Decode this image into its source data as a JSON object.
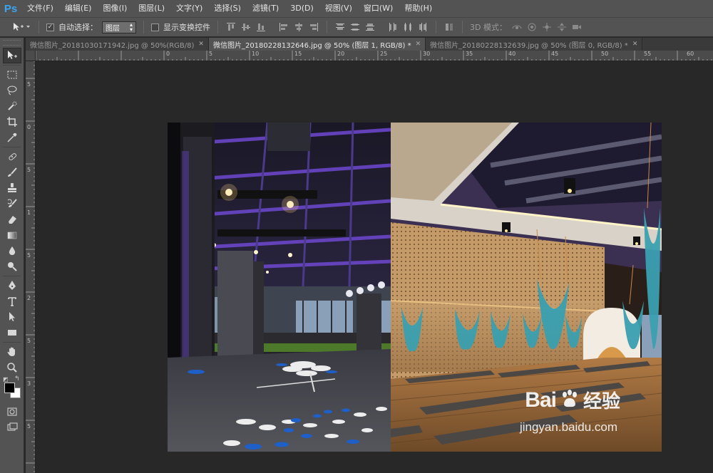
{
  "app": {
    "logo": "Ps"
  },
  "menu": [
    "文件(F)",
    "编辑(E)",
    "图像(I)",
    "图层(L)",
    "文字(Y)",
    "选择(S)",
    "滤镜(T)",
    "3D(D)",
    "视图(V)",
    "窗口(W)",
    "帮助(H)"
  ],
  "options": {
    "auto_select_label": "自动选择：",
    "auto_select_checked": true,
    "auto_select_value": "图层",
    "show_transform_label": "显示变换控件",
    "show_transform_checked": false,
    "mode_3d_label": "3D 模式："
  },
  "tabs": [
    {
      "title": "微信图片_20181030171942.jpg @ 50%(RGB/8)",
      "active": false
    },
    {
      "title": "微信图片_20180228132646.jpg @ 50% (图层 1, RGB/8) *",
      "active": true
    },
    {
      "title": "微信图片_20180228132639.jpg @ 50% (图层 0, RGB/8) *",
      "active": false
    }
  ],
  "ruler": {
    "top_labels": [
      "0",
      "5",
      "10",
      "15",
      "20",
      "25",
      "30",
      "35",
      "40",
      "45",
      "50",
      "55",
      "60"
    ],
    "left_labels": [
      "5",
      "0",
      "5",
      "1",
      "5",
      "2",
      "5",
      "3",
      "5"
    ]
  },
  "watermark": {
    "logo": "Bai",
    "logo_suffix": "经验",
    "url": "jingyan.baidu.com"
  },
  "colors": {
    "accent": "#39a6f1",
    "foreground": "#000000",
    "background": "#ffffff"
  }
}
